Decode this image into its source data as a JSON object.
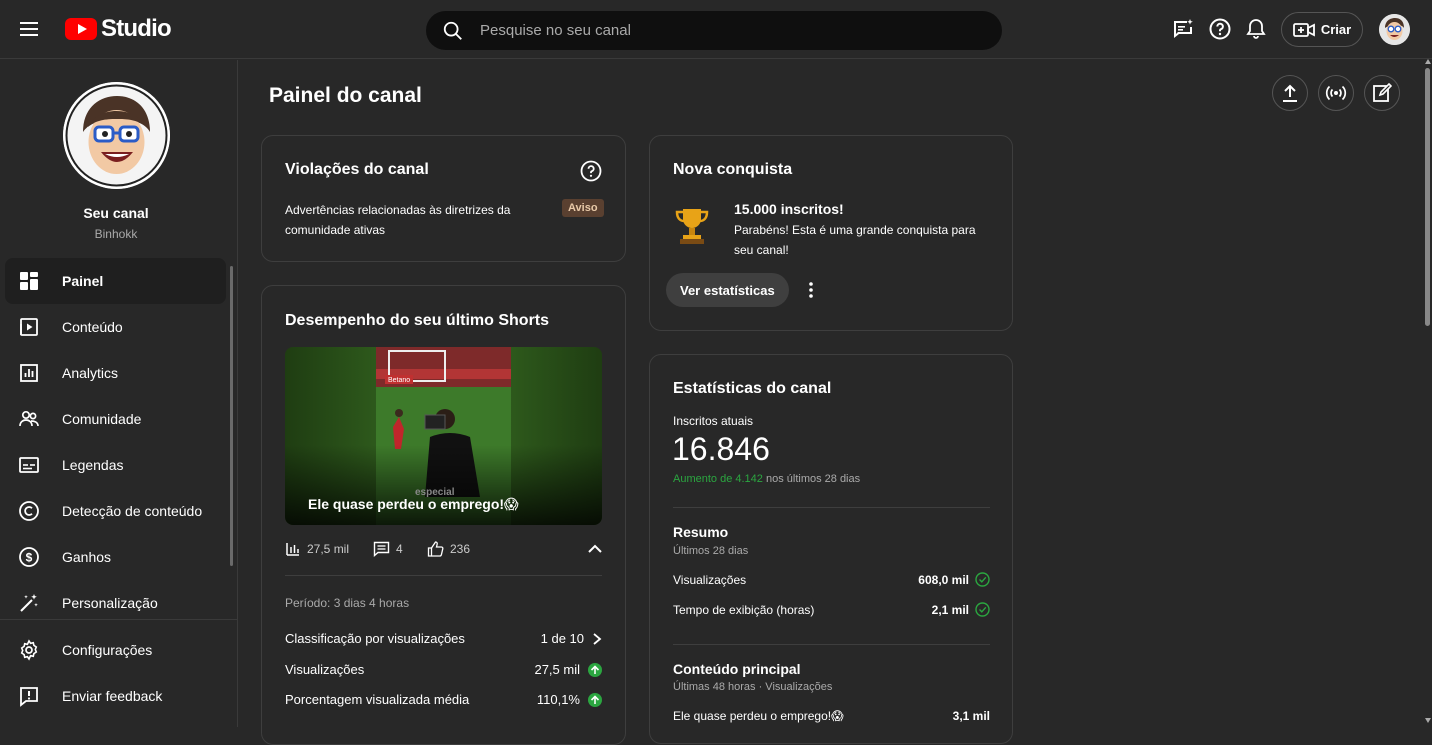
{
  "topbar": {
    "logo_text": "Studio",
    "search_placeholder": "Pesquise no seu canal",
    "create_label": "Criar"
  },
  "sidebar": {
    "channel_title": "Seu canal",
    "channel_name": "Binhokk",
    "items": [
      {
        "label": "Painel",
        "icon": "dashboard-icon",
        "active": true
      },
      {
        "label": "Conteúdo",
        "icon": "content-icon"
      },
      {
        "label": "Analytics",
        "icon": "analytics-icon"
      },
      {
        "label": "Comunidade",
        "icon": "community-icon"
      },
      {
        "label": "Legendas",
        "icon": "subtitles-icon"
      },
      {
        "label": "Detecção de conteúdo",
        "icon": "copyright-icon"
      },
      {
        "label": "Ganhos",
        "icon": "earnings-icon"
      },
      {
        "label": "Personalização",
        "icon": "customization-icon"
      }
    ],
    "bottom_items": [
      {
        "label": "Configurações",
        "icon": "settings-icon"
      },
      {
        "label": "Enviar feedback",
        "icon": "feedback-icon"
      }
    ]
  },
  "main": {
    "title": "Painel do canal"
  },
  "violations": {
    "title": "Violações do canal",
    "text": "Advertências relacionadas às diretrizes da comunidade ativas",
    "badge": "Aviso"
  },
  "achievement": {
    "title": "Nova conquista",
    "headline": "15.000 inscritos!",
    "text": "Parabéns! Esta é uma grande conquista para seu canal!",
    "button": "Ver estatísticas"
  },
  "shorts": {
    "title": "Desempenho do seu último Shorts",
    "video_caption": "Ele quase perdeu o emprego!😱",
    "overlay_tag": "especial",
    "views": "27,5 mil",
    "comments": "4",
    "likes": "236",
    "period": "Período: 3 dias 4 horas",
    "rows": [
      {
        "label": "Classificação por visualizações",
        "value": "1 de 10"
      },
      {
        "label": "Visualizações",
        "value": "27,5 mil"
      },
      {
        "label": "Porcentagem visualizada média",
        "value": "110,1%"
      }
    ]
  },
  "stats": {
    "title": "Estatísticas do canal",
    "subs_label": "Inscritos atuais",
    "subs_value": "16.846",
    "growth": "Aumento de 4.142",
    "growth_suffix": " nos últimos 28 dias",
    "summary_title": "Resumo",
    "summary_sub": "Últimos 28 dias",
    "summary_rows": [
      {
        "label": "Visualizações",
        "value": "608,0 mil"
      },
      {
        "label": "Tempo de exibição (horas)",
        "value": "2,1 mil"
      }
    ],
    "top_title": "Conteúdo principal",
    "top_sub": "Últimas 48 horas · Visualizações",
    "top_rows": [
      {
        "label": "Ele quase perdeu o emprego!😱",
        "value": "3,1 mil"
      }
    ]
  },
  "colors": {
    "accent_red": "#ff0000",
    "green": "#2ba640",
    "bg": "#282828"
  }
}
